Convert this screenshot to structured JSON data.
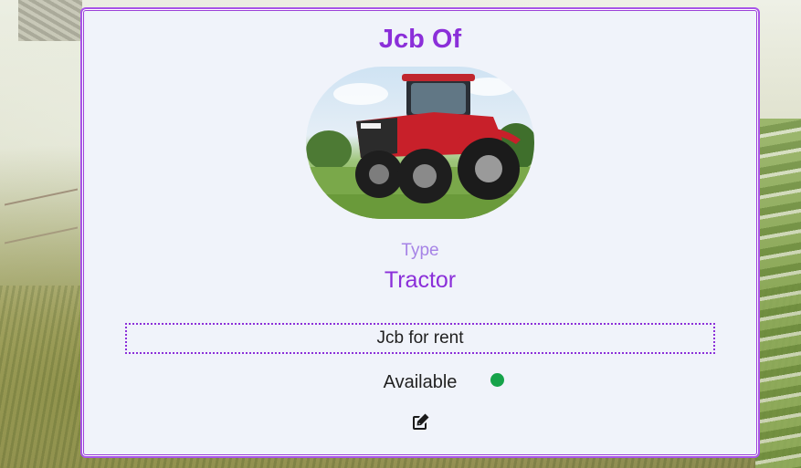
{
  "card": {
    "title": "Jcb Of",
    "image_alt": "Red tractor on grass field",
    "type_label": "Type",
    "type_value": "Tractor",
    "description": "Jcb for rent",
    "status_text": "Available",
    "status_color": "#16a34a",
    "edit_icon": "edit-icon"
  },
  "colors": {
    "accent": "#8b2fd9",
    "border": "#a855e8",
    "card_bg": "#f0f3fa",
    "type_label": "#a683e6"
  }
}
